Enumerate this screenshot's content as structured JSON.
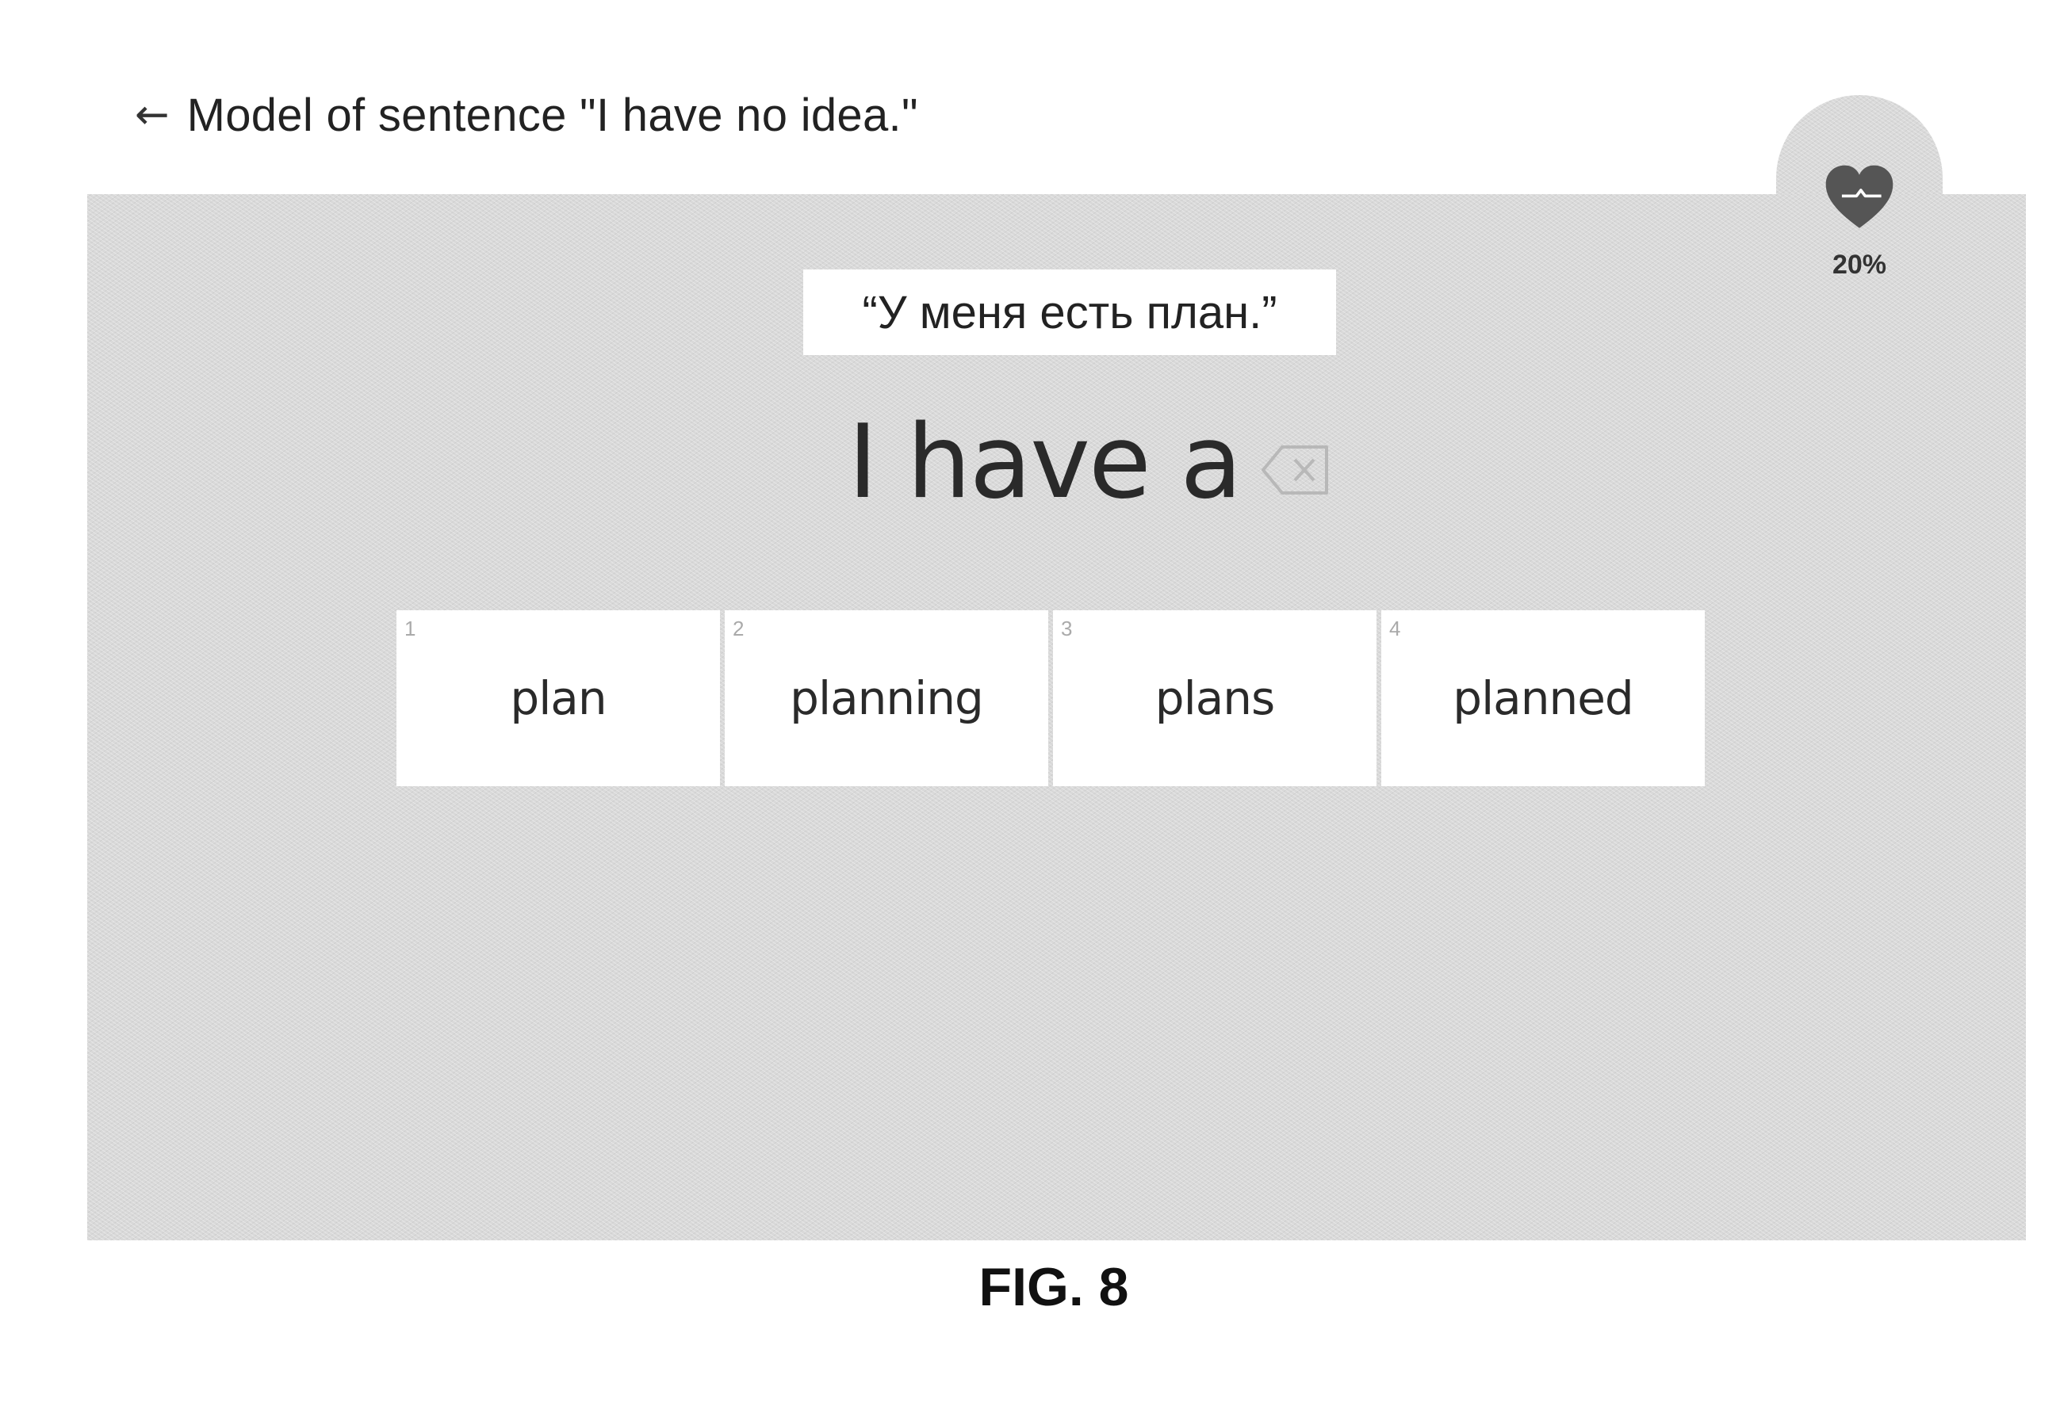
{
  "header": {
    "back_icon": "arrow-left-icon",
    "title": "Model of sentence \"I have no idea.\""
  },
  "health": {
    "icon": "heart-icon",
    "value_label": "20%",
    "value_fraction": 0.2
  },
  "prompt": {
    "text": "“У меня есть план.”"
  },
  "answer": {
    "text": "I have a",
    "backspace_icon": "backspace-icon"
  },
  "options": [
    {
      "number": "1",
      "word": "plan"
    },
    {
      "number": "2",
      "word": "planning"
    },
    {
      "number": "3",
      "word": "plans"
    },
    {
      "number": "4",
      "word": "planned"
    }
  ],
  "caption": "FIG. 8",
  "colors": {
    "panel": "#d9d9d9",
    "card": "#ffffff",
    "heart": "#555555"
  }
}
